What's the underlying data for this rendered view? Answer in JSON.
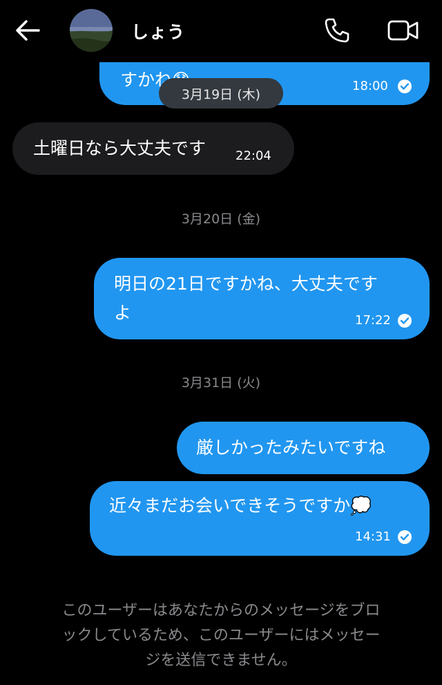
{
  "header": {
    "contact_name": "しょう",
    "icons": {
      "back": "back-arrow-icon",
      "call": "phone-icon",
      "video": "video-camera-icon"
    }
  },
  "messages": [
    {
      "direction": "out",
      "text": "すかね😯",
      "time": "18:00",
      "read": true,
      "partially_hidden": true
    },
    {
      "date": "3月19日 (木)"
    },
    {
      "direction": "in",
      "text": "土曜日なら大丈夫です",
      "time": "22:04"
    },
    {
      "date": "3月20日 (金)"
    },
    {
      "direction": "out",
      "text_lines": [
        "明日の21日ですかね、大丈夫です",
        "よ"
      ],
      "time": "17:22",
      "read": true
    },
    {
      "date": "3月31日 (火)"
    },
    {
      "direction": "out",
      "text": "厳しかったみたいですね"
    },
    {
      "direction": "out",
      "text": "近々まだお会いできそうですか💭",
      "time": "14:31",
      "read": true
    }
  ],
  "footer": {
    "notice_lines": [
      "このユーザーはあなたからのメッセージをブロ",
      "ックしているため、このユーザーにはメッセー",
      "ジを送信できません。"
    ]
  },
  "colors": {
    "outgoing_bubble": "#2196f0",
    "incoming_bubble": "#1c1c1e",
    "background": "#000000",
    "muted_text": "#8a8a8e"
  }
}
